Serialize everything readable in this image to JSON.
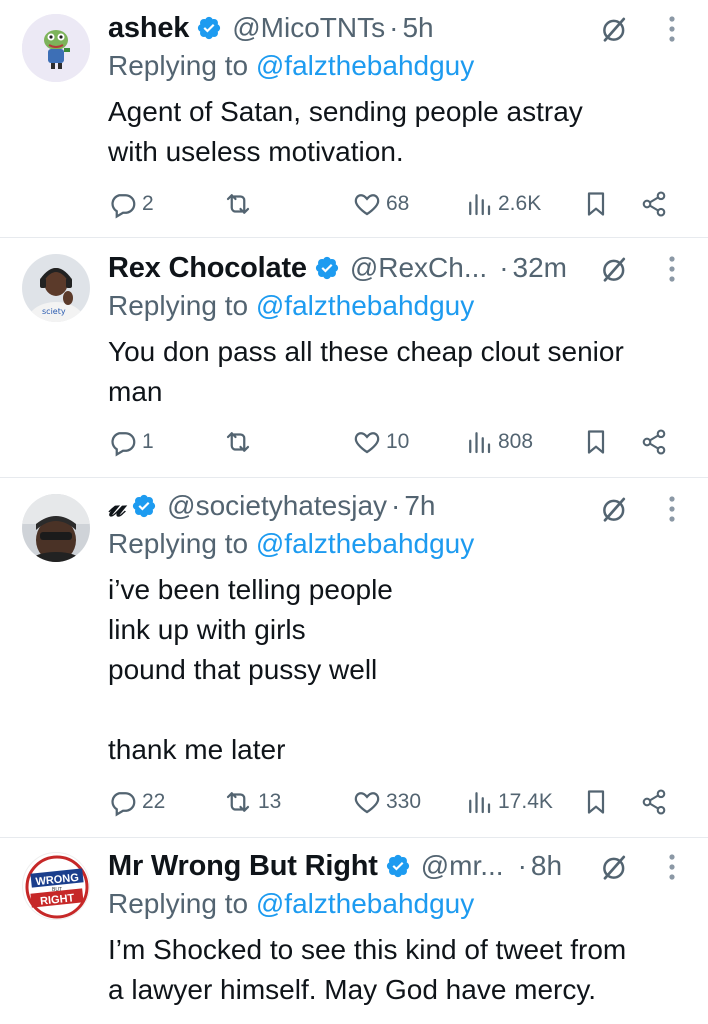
{
  "tweets": [
    {
      "name": "ashek",
      "handle": "@MicoTNTs",
      "time": "5h",
      "reply_prefix": "Replying to ",
      "reply_to": "@falzthebahdguy",
      "text": "Agent of Satan, sending people astray\nwith useless motivation.",
      "replies": "2",
      "retweets": "",
      "likes": "68",
      "views": "2.6K",
      "avatar": "pepe-frog-avatar"
    },
    {
      "name": "Rex Chocolate",
      "handle": "@RexCh...",
      "time": "32m",
      "reply_prefix": "Replying to ",
      "reply_to": "@falzthebahdguy",
      "text": "You don pass all these cheap clout senior\nman",
      "replies": "1",
      "retweets": "",
      "likes": "10",
      "views": "808",
      "avatar": "man-with-headphones-avatar"
    },
    {
      "name": "𝓊",
      "handle": "@societyhatesjay",
      "time": "7h",
      "reply_prefix": "Replying to ",
      "reply_to": "@falzthebahdguy",
      "text": "i’ve been telling people\nlink up with girls\npound that pussy well\n\nthank me later",
      "replies": "22",
      "retweets": "13",
      "likes": "330",
      "views": "17.4K",
      "avatar": "selfie-avatar"
    },
    {
      "name": "Mr Wrong But Right",
      "handle": "@mr...",
      "time": "8h",
      "reply_prefix": "Replying to ",
      "reply_to": "@falzthebahdguy",
      "text": "I’m Shocked to see this kind of tweet from\na lawyer himself. May God have mercy.",
      "avatar": "wrong-but-right-logo",
      "logo_text": [
        "WRONG",
        "BUT",
        "RIGHT"
      ]
    }
  ],
  "separator": "·",
  "colors": {
    "accent": "#1d9bf0",
    "muted": "#536471",
    "text": "#0f1419",
    "verified": "#1d9bf0"
  }
}
